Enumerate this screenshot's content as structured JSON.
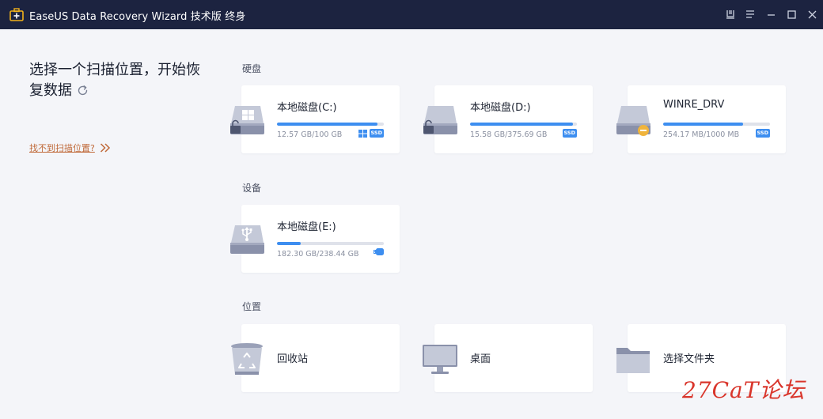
{
  "titlebar": {
    "title": "EaseUS Data Recovery Wizard 技术版 终身"
  },
  "left": {
    "title": "选择一个扫描位置，开始恢复数据",
    "not_found_link": "找不到扫描位置?"
  },
  "sections": {
    "disks": "硬盘",
    "devices": "设备",
    "locations": "位置"
  },
  "disks": [
    {
      "name": "本地磁盘(C:)",
      "size": "12.57 GB/100 GB",
      "usage_fraction": 0.94,
      "badges": [
        "windows-icon",
        "SSD"
      ]
    },
    {
      "name": "本地磁盘(D:)",
      "size": "15.58 GB/375.69 GB",
      "usage_fraction": 0.96,
      "badges": [
        "SSD"
      ]
    },
    {
      "name": "WINRE_DRV",
      "size": "254.17 MB/1000 MB",
      "usage_fraction": 0.75,
      "badges": [
        "SSD"
      ]
    }
  ],
  "devices": [
    {
      "name": "本地磁盘(E:)",
      "size": "182.30 GB/238.44 GB",
      "usage_fraction": 0.22,
      "badges": [
        "usb-drive-icon"
      ]
    }
  ],
  "locations": [
    {
      "name": "回收站",
      "icon": "recycle-bin-icon"
    },
    {
      "name": "桌面",
      "icon": "monitor-icon"
    },
    {
      "name": "选择文件夹",
      "icon": "folder-icon"
    }
  ],
  "watermark": "27CaT论坛",
  "colors": {
    "titlebar": "#1c2340",
    "accent": "#3d8ef0",
    "link": "#c06a3a",
    "watermark": "#d9352b"
  }
}
